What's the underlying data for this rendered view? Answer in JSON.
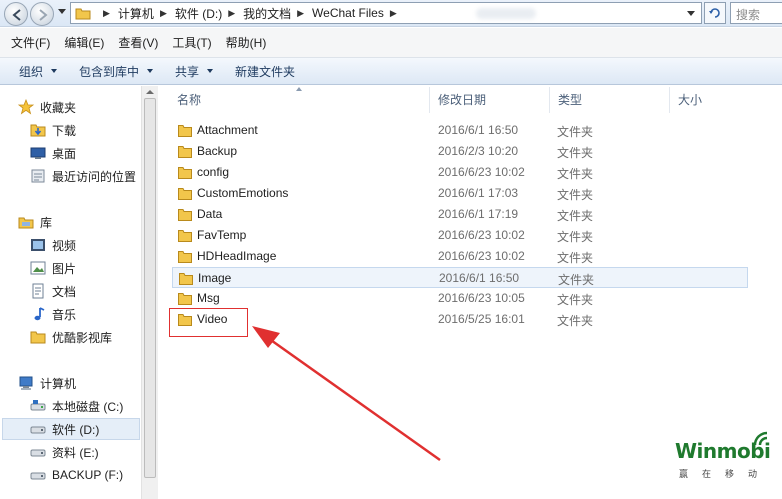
{
  "address_bar": {
    "breadcrumbs": [
      "计算机",
      "软件 (D:)",
      "我的文档",
      "WeChat Files"
    ],
    "search_placeholder": "搜索 "
  },
  "menu": [
    "文件(F)",
    "编辑(E)",
    "查看(V)",
    "工具(T)",
    "帮助(H)"
  ],
  "commands": [
    {
      "label": "组织",
      "dropdown": true
    },
    {
      "label": "包含到库中",
      "dropdown": true
    },
    {
      "label": "共享",
      "dropdown": true
    },
    {
      "label": "新建文件夹",
      "dropdown": false
    }
  ],
  "nav": {
    "favorites": {
      "label": "收藏夹",
      "icon": "star-icon",
      "items": [
        {
          "label": "下载",
          "icon": "download-folder-icon"
        },
        {
          "label": "桌面",
          "icon": "desktop-icon"
        },
        {
          "label": "最近访问的位置",
          "icon": "recent-places-icon"
        }
      ]
    },
    "libraries": {
      "label": "库",
      "icon": "library-icon",
      "items": [
        {
          "label": "视频",
          "icon": "video-library-icon"
        },
        {
          "label": "图片",
          "icon": "picture-library-icon"
        },
        {
          "label": "文档",
          "icon": "document-library-icon"
        },
        {
          "label": "音乐",
          "icon": "music-library-icon"
        },
        {
          "label": "优酷影视库",
          "icon": "folder-icon"
        }
      ]
    },
    "computer": {
      "label": "计算机",
      "icon": "computer-icon",
      "items": [
        {
          "label": "本地磁盘 (C:)",
          "icon": "drive-icon"
        },
        {
          "label": "软件 (D:)",
          "icon": "drive-icon",
          "selected": true
        },
        {
          "label": "资料 (E:)",
          "icon": "drive-icon"
        },
        {
          "label": "BACKUP (F:)",
          "icon": "drive-icon"
        }
      ]
    }
  },
  "columns": [
    "名称",
    "修改日期",
    "类型",
    "大小"
  ],
  "files": [
    {
      "name": "Attachment",
      "date": "2016/6/1 16:50",
      "type": "文件夹"
    },
    {
      "name": "Backup",
      "date": "2016/2/3 10:20",
      "type": "文件夹"
    },
    {
      "name": "config",
      "date": "2016/6/23 10:02",
      "type": "文件夹"
    },
    {
      "name": "CustomEmotions",
      "date": "2016/6/1 17:03",
      "type": "文件夹"
    },
    {
      "name": "Data",
      "date": "2016/6/1 17:19",
      "type": "文件夹"
    },
    {
      "name": "FavTemp",
      "date": "2016/6/23 10:02",
      "type": "文件夹"
    },
    {
      "name": "HDHeadImage",
      "date": "2016/6/23 10:02",
      "type": "文件夹"
    },
    {
      "name": "Image",
      "date": "2016/6/1 16:50",
      "type": "文件夹",
      "selected": true
    },
    {
      "name": "Msg",
      "date": "2016/6/23 10:05",
      "type": "文件夹"
    },
    {
      "name": "Video",
      "date": "2016/5/25 16:01",
      "type": "文件夹",
      "highlighted": true
    }
  ],
  "watermark": {
    "main": "Winmobi",
    "sub": "赢在移动"
  },
  "colors": {
    "annotation_red": "#e03030",
    "folder_yellow": "#f2c64b",
    "watermark_green": "#1f7a2e"
  }
}
